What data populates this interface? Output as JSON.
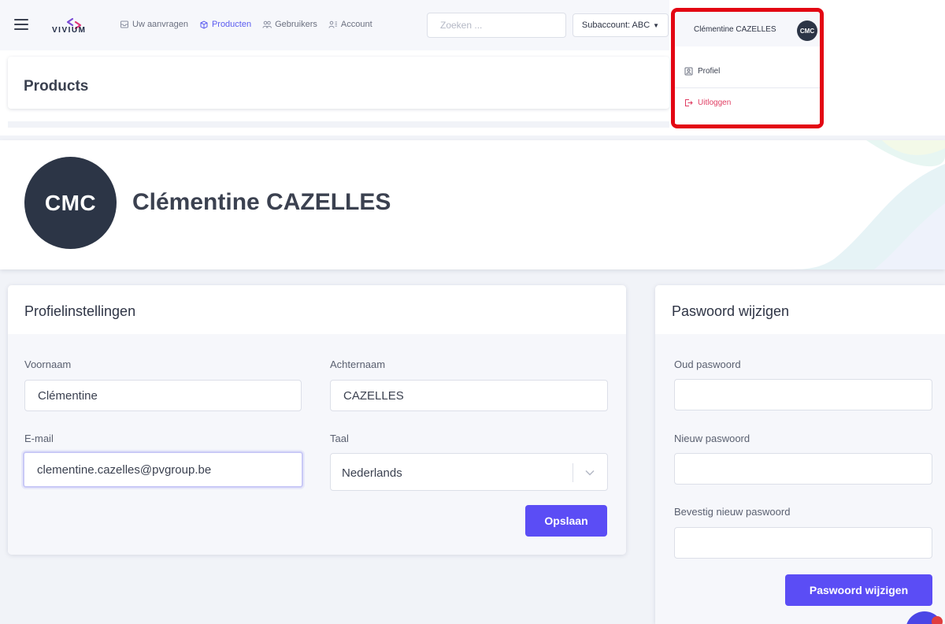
{
  "nav": {
    "logo_text": "VIVIUM",
    "links": [
      {
        "label": "Uw aanvragen",
        "icon": "inbox-icon",
        "active": false
      },
      {
        "label": "Producten",
        "icon": "box-icon",
        "active": true
      },
      {
        "label": "Gebruikers",
        "icon": "users-icon",
        "active": false
      },
      {
        "label": "Account",
        "icon": "account-icon",
        "active": false
      }
    ],
    "search_placeholder": "Zoeken ...",
    "subaccount_label": "Subaccount: ABC",
    "user_name": "Clémentine CAZELLES",
    "user_initials": "CMC"
  },
  "user_menu": {
    "profiel": "Profiel",
    "uitloggen": "Uitloggen"
  },
  "page": {
    "title": "Products"
  },
  "profile_header": {
    "initials": "CMC",
    "name": "Clémentine CAZELLES"
  },
  "profile_settings": {
    "title": "Profielinstellingen",
    "voornaam_label": "Voornaam",
    "voornaam_value": "Clémentine",
    "achternaam_label": "Achternaam",
    "achternaam_value": "CAZELLES",
    "email_label": "E-mail",
    "email_value": "clementine.cazelles@pvgroup.be",
    "taal_label": "Taal",
    "taal_value": "Nederlands",
    "save_label": "Opslaan"
  },
  "password": {
    "title": "Paswoord wijzigen",
    "old_label": "Oud paswoord",
    "new_label": "Nieuw paswoord",
    "confirm_label": "Bevestig nieuw paswoord",
    "submit_label": "Paswoord wijzigen"
  },
  "colors": {
    "accent": "#5b4df5",
    "highlight_border": "#e30613",
    "logout_text": "#e03e63",
    "avatar_bg": "#2c3546"
  }
}
